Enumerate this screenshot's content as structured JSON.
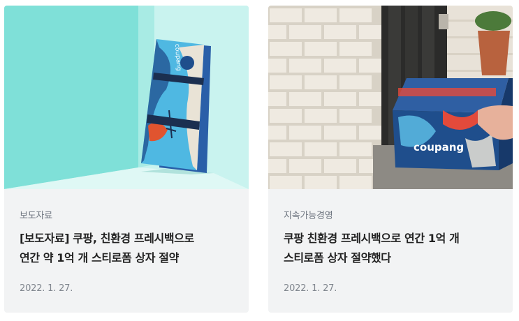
{
  "cards": [
    {
      "category": "보도자료",
      "title_line1": "[보도자료] 쿠팡, 친환경 프레시백으로",
      "title_line2": "연간 약 1억 개 스티로폼 상자 절약",
      "date": "2022. 1. 27.",
      "image_alt": "folded fresh bag leaning against mint wall",
      "bag_logo": "coupang"
    },
    {
      "category": "지속가능경영",
      "title_line1": "쿠팡 친환경 프레시백으로 연간 1억 개",
      "title_line2": "스티로폼 상자 절약했다",
      "date": "2022. 1. 27.",
      "image_alt": "fresh bag on doorstep beside brick wall",
      "bag_logo": "coupang"
    }
  ],
  "colors": {
    "card_bg": "#f2f3f4",
    "mint_wall": "#7fe0d8",
    "bag_blue": "#1f4e8c"
  }
}
